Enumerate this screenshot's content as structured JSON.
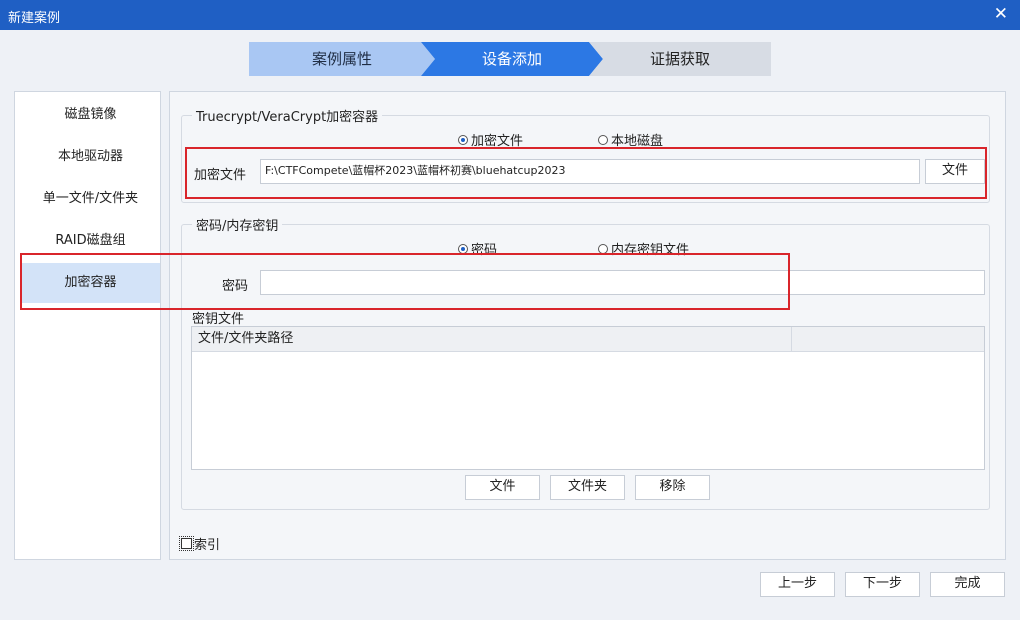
{
  "window": {
    "title": "新建案例"
  },
  "steps": [
    {
      "label": "案例属性"
    },
    {
      "label": "设备添加"
    },
    {
      "label": "证据获取"
    }
  ],
  "nav": {
    "items": [
      {
        "label": "磁盘镜像"
      },
      {
        "label": "本地驱动器"
      },
      {
        "label": "单一文件/文件夹"
      },
      {
        "label": "RAID磁盘组"
      },
      {
        "label": "加密容器"
      }
    ]
  },
  "container": {
    "group_title": "Truecrypt/VeraCrypt加密容器",
    "radio_file": "加密文件",
    "radio_disk": "本地磁盘",
    "file_label": "加密文件",
    "file_path": "F:\\CTFCompete\\蓝帽杯2023\\蓝帽杯初赛\\bluehatcup2023",
    "file_button": "文件"
  },
  "password": {
    "group_title": "密码/内存密钥",
    "radio_password": "密码",
    "radio_keyfile": "内存密钥文件",
    "password_label": "密码",
    "password_value": "",
    "keyfile_label": "密钥文件",
    "column_path": "文件/文件夹路径",
    "column_extra": "",
    "btn_file": "文件",
    "btn_folder": "文件夹",
    "btn_remove": "移除"
  },
  "index_label": "索引",
  "footer": {
    "prev": "上一步",
    "next": "下一步",
    "finish": "完成"
  },
  "colors": {
    "titlebar": "#1f5fc4",
    "active_step": "#2c78e4",
    "highlight": "#d9252b"
  }
}
